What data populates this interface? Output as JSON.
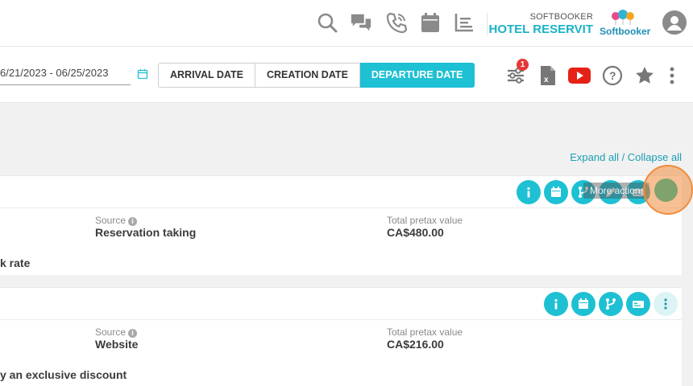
{
  "header": {
    "brand_small": "SOFTBOOKER",
    "hotel_name": "HOTEL RESERVIT",
    "logo_text": "Softbooker",
    "icons": [
      "search-icon",
      "chat-icon",
      "phone-icon",
      "calendar-icon",
      "chart-icon",
      "user-icon"
    ]
  },
  "filters": {
    "date_range": "6/21/2023 - 06/25/2023",
    "tabs": [
      {
        "label": "ARRIVAL DATE",
        "active": false
      },
      {
        "label": "CREATION DATE",
        "active": false
      },
      {
        "label": "DEPARTURE DATE",
        "active": true
      }
    ],
    "filter_badge": "1",
    "tool_icons": [
      "filter-settings-icon",
      "excel-export-icon",
      "youtube-icon",
      "help-icon",
      "star-icon",
      "kebab-menu-icon"
    ]
  },
  "expand_collapse": "Expand all / Collapse all",
  "tooltip": "More actions",
  "reservations": [
    {
      "source_label": "Source",
      "source_value": "Reservation taking",
      "total_label": "Total pretax value",
      "total_value": "CA$480.00",
      "rate_text": "k rate"
    },
    {
      "source_label": "Source",
      "source_value": "Website",
      "total_label": "Total pretax value",
      "total_value": "CA$216.00",
      "rate_text": "y an exclusive discount"
    }
  ],
  "colors": {
    "accent": "#1ec0d3",
    "brand_text": "#1ab2c5",
    "badge": "#e53935",
    "youtube": "#e62117"
  }
}
